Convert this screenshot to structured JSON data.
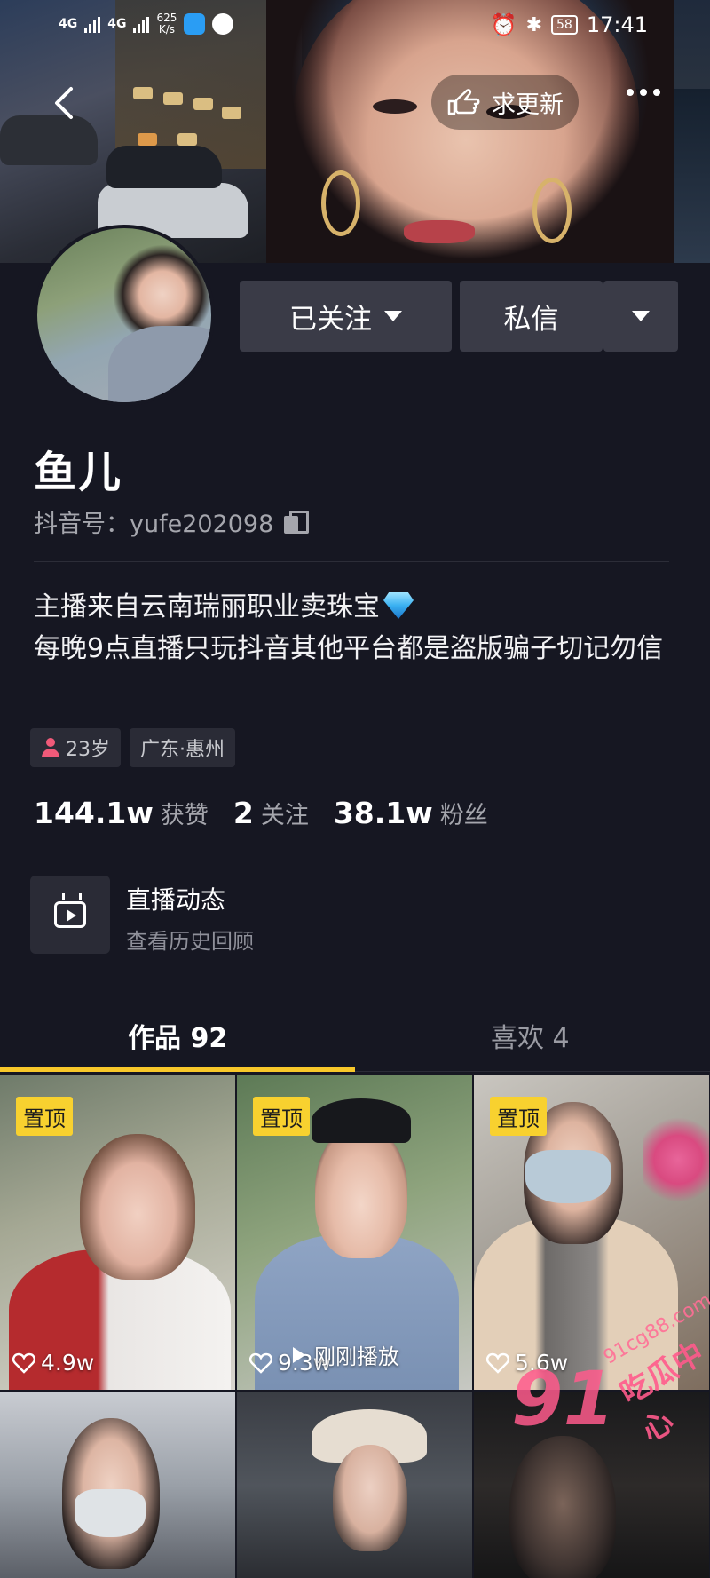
{
  "status_bar": {
    "network1": "4G",
    "network2": "4G",
    "speed_value": "625",
    "speed_unit": "K/s",
    "battery": "58",
    "time": "17:41"
  },
  "header": {
    "request_update_label": "求更新"
  },
  "profile": {
    "follow_button_label": "已关注",
    "message_button_label": "私信",
    "name": "鱼儿",
    "douyin_id": "抖音号：yufe202098",
    "bio_line1": "主播来自云南瑞丽职业卖珠宝",
    "bio_line2": "每晚9点直播只玩抖音其他平台都是盗版骗子切记勿信",
    "age_tag": "23岁",
    "location_tag": "广东·惠州"
  },
  "stats": {
    "likes_num": "144.1w",
    "likes_label": "获赞",
    "following_num": "2",
    "following_label": "关注",
    "fans_num": "38.1w",
    "fans_label": "粉丝"
  },
  "live": {
    "title": "直播动态",
    "subtitle": "查看历史回顾"
  },
  "tabs": {
    "works_label": "作品 92",
    "likes_label": "喜欢 4"
  },
  "videos": [
    {
      "pinned_label": "置顶",
      "likes": "4.9w"
    },
    {
      "pinned_label": "置顶",
      "likes": "9.3w"
    },
    {
      "pinned_label": "置顶",
      "likes": "5.6w"
    }
  ],
  "just_played_label": "刚刚播放",
  "watermark": {
    "number": "91",
    "site": "91cg88.com",
    "name": "吃瓜中心"
  },
  "colors": {
    "background": "#161722",
    "button": "#3a3b47",
    "accent_yellow": "#f8c82a",
    "pin_badge": "#f8d12f",
    "muted_text": "#a5a6ad"
  }
}
